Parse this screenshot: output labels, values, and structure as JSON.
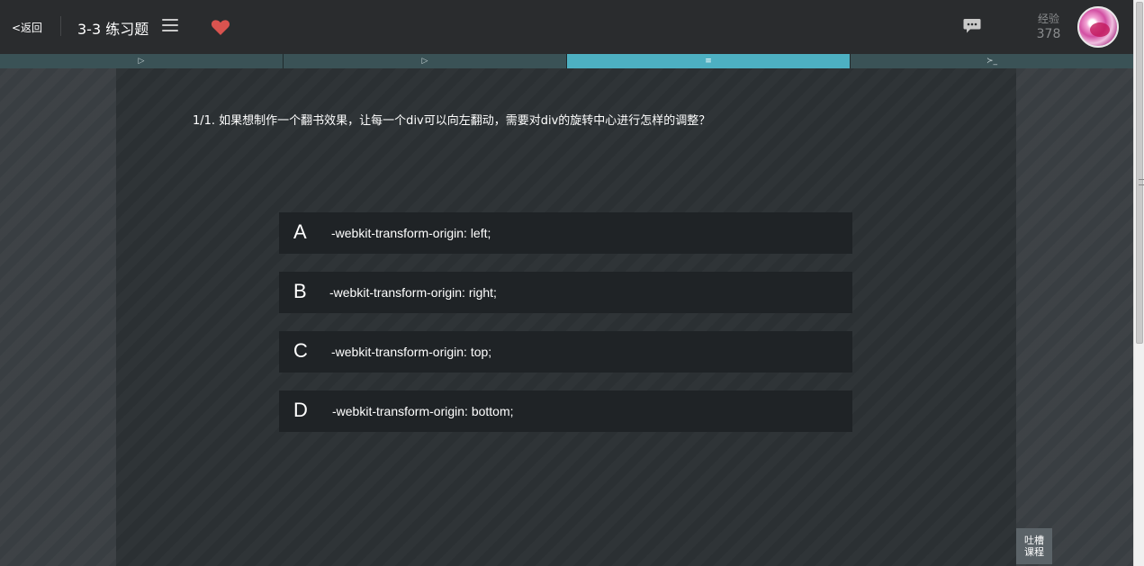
{
  "header": {
    "back_label": "<返回",
    "lesson_title": "3-3 练习题",
    "exp_label": "经验",
    "exp_value": "378"
  },
  "tabs": [
    {
      "icon": "▷",
      "name": "play-icon"
    },
    {
      "icon": "▷",
      "name": "play-icon"
    },
    {
      "icon": "≡",
      "name": "list-icon",
      "active": true
    },
    {
      "icon": "≻_",
      "name": "terminal-icon"
    }
  ],
  "quiz": {
    "question": "1/1. 如果想制作一个翻书效果，让每一个div可以向左翻动，需要对div的旋转中心进行怎样的调整？",
    "options": [
      {
        "letter": "A",
        "text": "-webkit-transform-origin: left;"
      },
      {
        "letter": "B",
        "text": "-webkit-transform-origin: right;"
      },
      {
        "letter": "C",
        "text": "-webkit-transform-origin: top;"
      },
      {
        "letter": "D",
        "text": "-webkit-transform-origin: bottom;"
      }
    ]
  },
  "feedback": {
    "line1": "吐槽",
    "line2": "课程"
  },
  "colors": {
    "header_bg": "#2a2c2e",
    "tab_bg": "#3a5256",
    "tab_active": "#4db0c2",
    "option_bg": "#1f2326",
    "heart": "#d9534f"
  }
}
